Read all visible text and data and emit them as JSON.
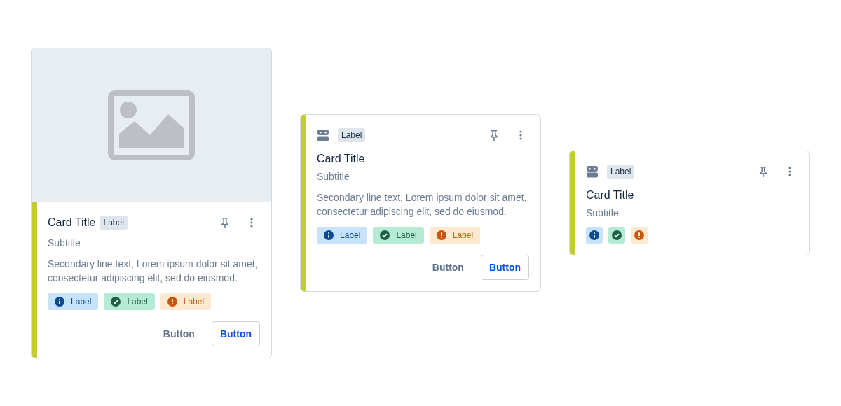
{
  "cards": [
    {
      "kind": "media",
      "label": "Label",
      "title": "Card Title",
      "subtitle": "Subtitle",
      "description": "Secondary line text, Lorem ipsum dolor sit amet, consectetur adipiscing elit, sed do eiusmod.",
      "tags": [
        {
          "kind": "info",
          "label": "Label"
        },
        {
          "kind": "success",
          "label": "Label"
        },
        {
          "kind": "warning",
          "label": "Label"
        }
      ],
      "buttons": [
        {
          "kind": "ghost",
          "label": "Button"
        },
        {
          "kind": "outline",
          "label": "Button"
        }
      ]
    },
    {
      "kind": "avatar",
      "label": "Label",
      "title": "Card Title",
      "subtitle": "Subtitle",
      "description": "Secondary line text, Lorem ipsum dolor sit amet, consectetur adipiscing elit, sed do eiusmod.",
      "tags": [
        {
          "kind": "info",
          "label": "Label"
        },
        {
          "kind": "success",
          "label": "Label"
        },
        {
          "kind": "warning",
          "label": "Label"
        }
      ],
      "buttons": [
        {
          "kind": "ghost",
          "label": "Button"
        },
        {
          "kind": "outline",
          "label": "Button"
        }
      ]
    },
    {
      "kind": "avatar",
      "label": "Label",
      "title": "Card Title",
      "subtitle": "Subtitle",
      "tags": [
        {
          "kind": "info"
        },
        {
          "kind": "success"
        },
        {
          "kind": "warning"
        }
      ]
    }
  ]
}
